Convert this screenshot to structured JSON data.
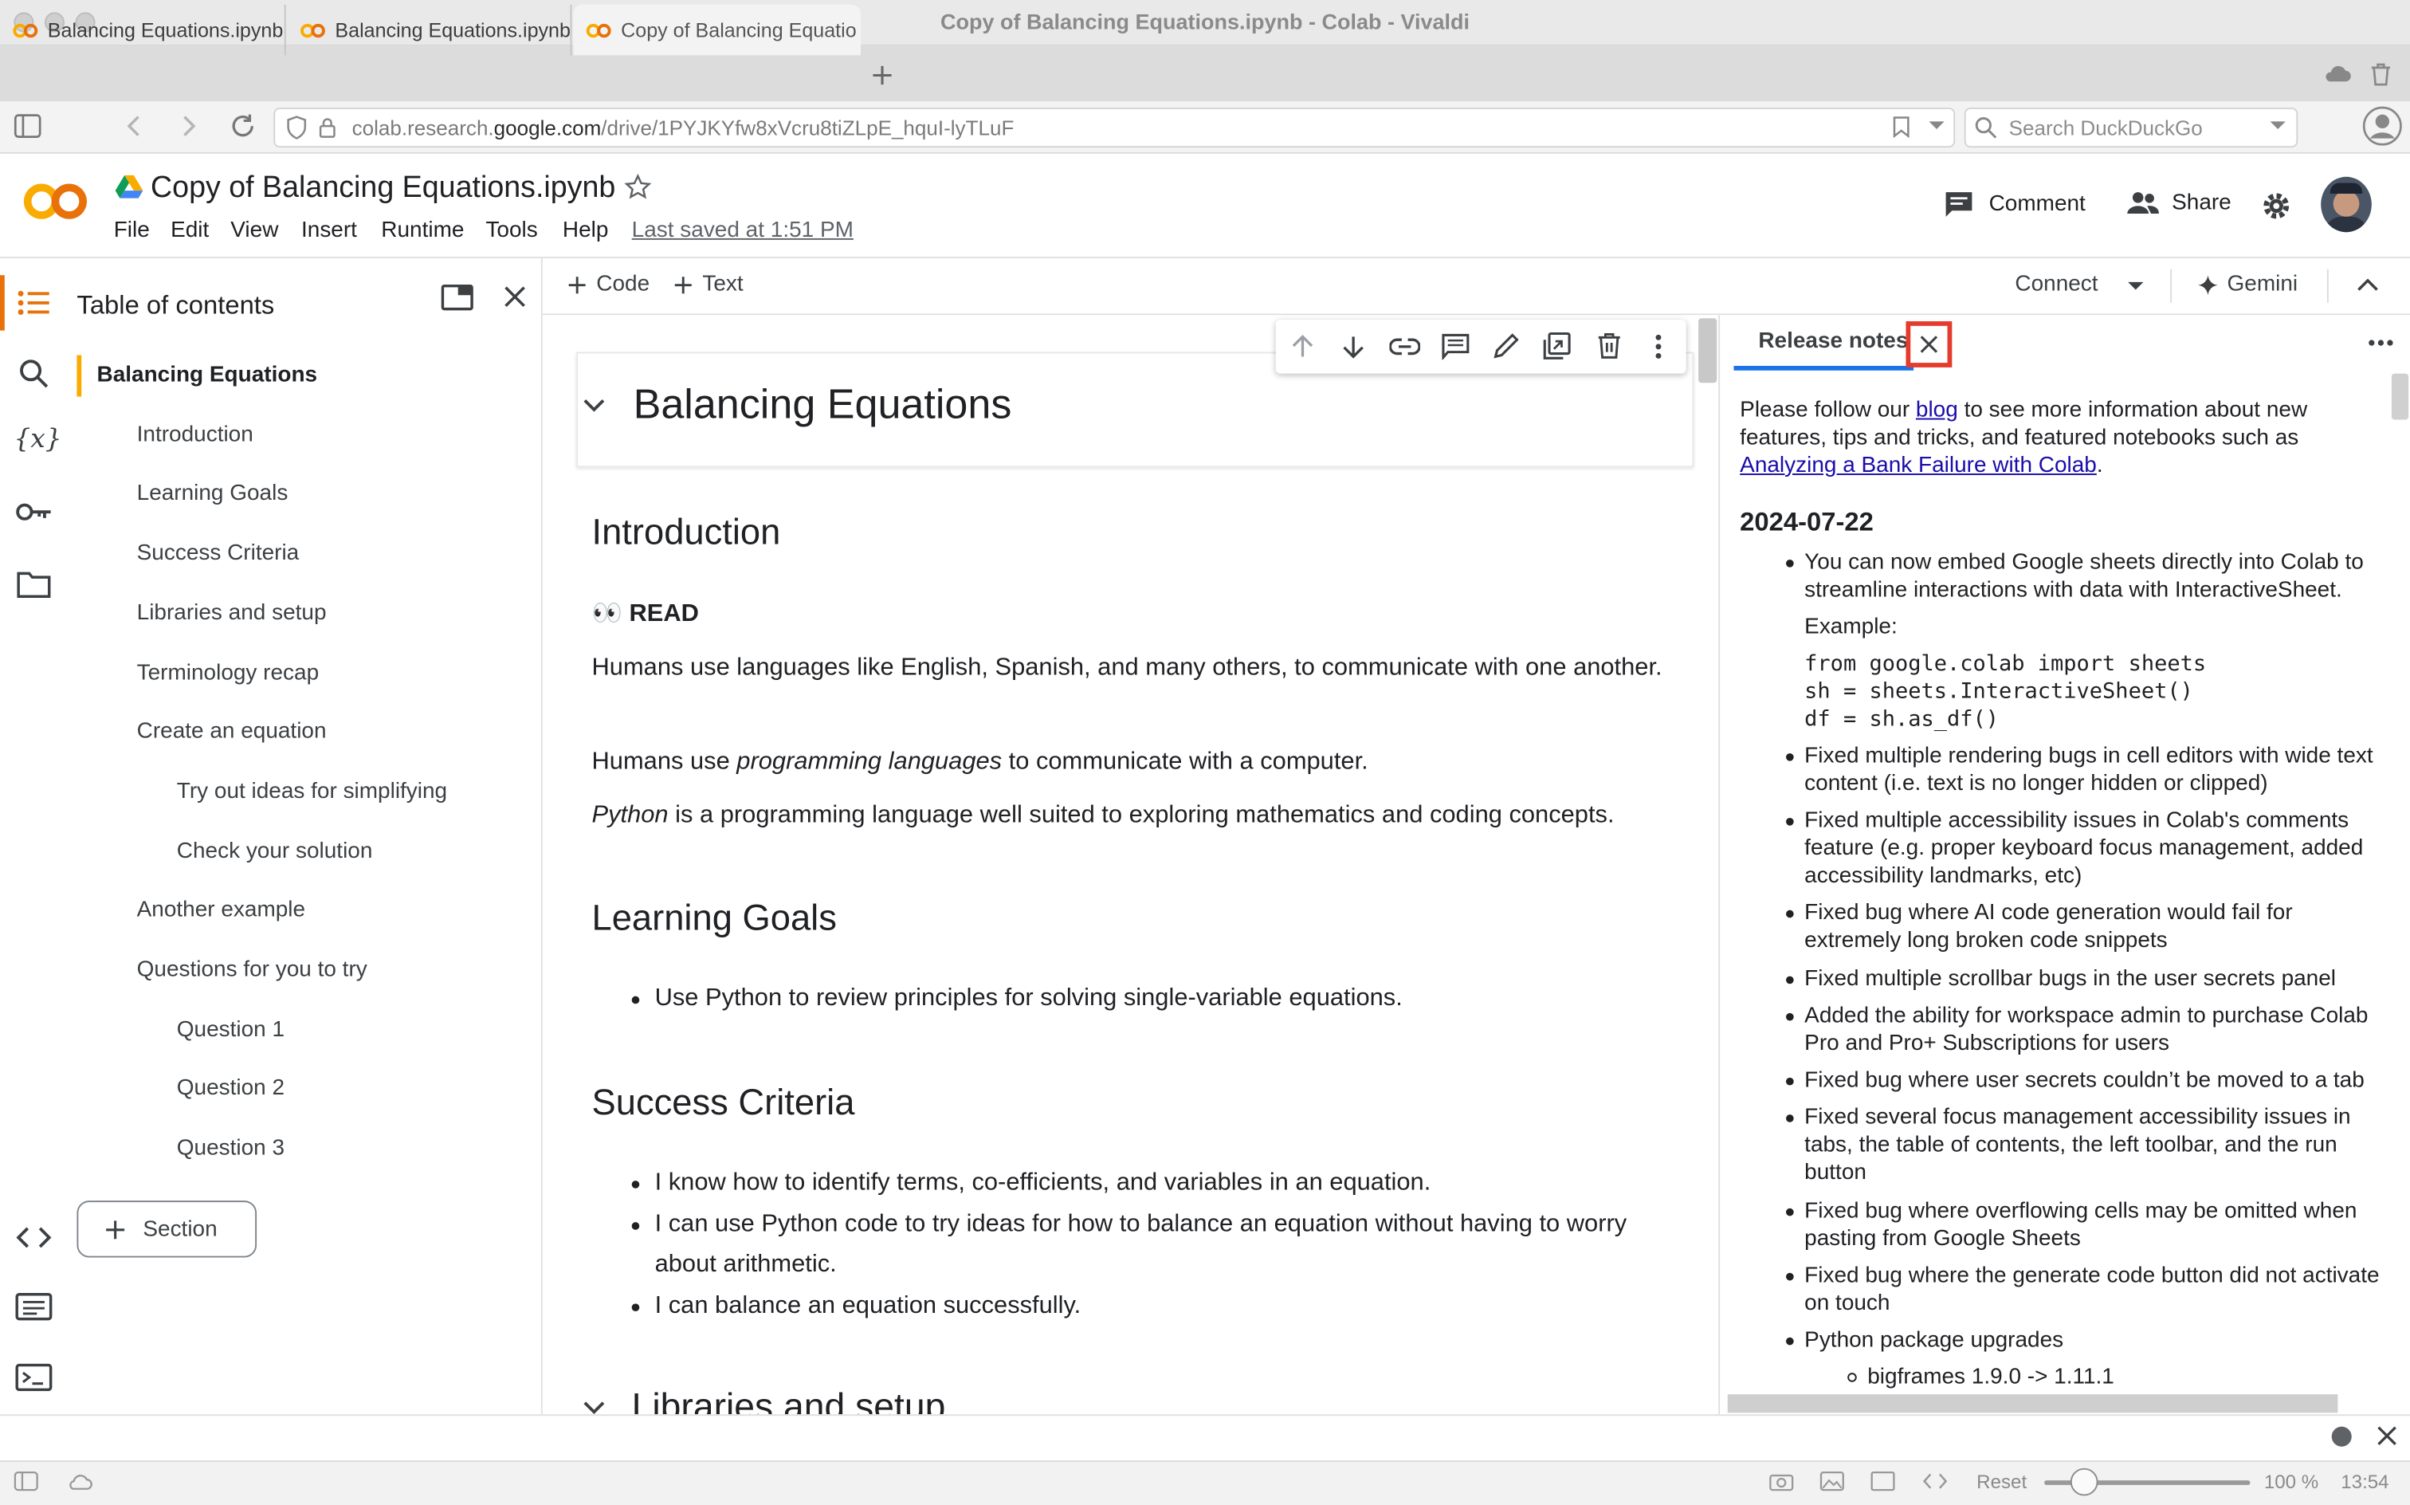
{
  "window": {
    "title": "Copy of Balancing Equations.ipynb - Colab - Vivaldi"
  },
  "browser_tabs": [
    {
      "label": "Balancing Equations.ipynb"
    },
    {
      "label": "Balancing Equations.ipynb"
    },
    {
      "label": "Copy of Balancing Equatio"
    }
  ],
  "address": {
    "prefix": "colab.research.",
    "host": "google.com",
    "path": "/drive/1PYJKYfw8xVcru8tiZLpE_hquI-lyTLuF"
  },
  "search": {
    "placeholder": "Search DuckDuckGo"
  },
  "colab": {
    "notebook_title": "Copy of Balancing Equations.ipynb",
    "menu": [
      "File",
      "Edit",
      "View",
      "Insert",
      "Runtime",
      "Tools",
      "Help"
    ],
    "last_saved": "Last saved at 1:51 PM",
    "comment_label": "Comment",
    "share_label": "Share",
    "add_code": "Code",
    "add_text": "Text",
    "connect_label": "Connect",
    "gemini_label": "Gemini"
  },
  "toc": {
    "title": "Table of contents",
    "items": [
      {
        "label": "Balancing Equations",
        "level": 1
      },
      {
        "label": "Introduction",
        "level": 2
      },
      {
        "label": "Learning Goals",
        "level": 2
      },
      {
        "label": "Success Criteria",
        "level": 2
      },
      {
        "label": "Libraries and setup",
        "level": 2
      },
      {
        "label": "Terminology recap",
        "level": 2
      },
      {
        "label": "Create an equation",
        "level": 2
      },
      {
        "label": "Try out ideas for simplifying",
        "level": 3
      },
      {
        "label": "Check your solution",
        "level": 3
      },
      {
        "label": "Another example",
        "level": 2
      },
      {
        "label": "Questions for you to try",
        "level": 2
      },
      {
        "label": "Question 1",
        "level": 3
      },
      {
        "label": "Question 2",
        "level": 3
      },
      {
        "label": "Question 3",
        "level": 3
      }
    ],
    "section_button": "Section"
  },
  "notebook": {
    "heading": "Balancing Equations",
    "intro_heading": "Introduction",
    "read_label": "READ",
    "read_emoji": "👀",
    "para1": "Humans use languages like English, Spanish, and many others, to communicate with one another.",
    "para2_pre": "Humans use ",
    "para2_em": "programming languages",
    "para2_post": " to communicate with a computer.",
    "para3_em": "Python",
    "para3_post": " is a programming language well suited to exploring mathematics and coding concepts.",
    "goals_heading": "Learning Goals",
    "goals": [
      "Use Python to review principles for solving single-variable equations."
    ],
    "criteria_heading": "Success Criteria",
    "criteria": [
      "I know how to identify terms, co-efficients, and variables in an equation.",
      "I can use Python code to try ideas for how to balance an equation without having to worry about arithmetic.",
      "I can balance an equation successfully."
    ],
    "libs_heading": "Libraries and setup"
  },
  "release_notes": {
    "tab_label": "Release notes",
    "intro_pre": "Please follow our ",
    "intro_link": "blog",
    "intro_mid": " to see more information about new features, tips and tricks, and featured notebooks such as ",
    "intro_link2": "Analyzing a Bank Failure with Colab",
    "intro_end": ".",
    "date": "2024-07-22",
    "item1": "You can now embed Google sheets directly into Colab to streamline interactions with data with InteractiveSheet.",
    "example_label": "Example:",
    "code": "from google.colab import sheets\nsh = sheets.InteractiveSheet()\ndf = sh.as_df()",
    "items": [
      "Fixed multiple rendering bugs in cell editors with wide text content (i.e. text is no longer hidden or clipped)",
      "Fixed multiple accessibility issues in Colab's comments feature (e.g. proper keyboard focus management, added accessibility landmarks, etc)",
      "Fixed bug where AI code generation would fail for extremely long broken code snippets",
      "Fixed multiple scrollbar bugs in the user secrets panel",
      "Added the ability for workspace admin to purchase Colab Pro and Pro+ Subscriptions for users",
      "Fixed bug where user secrets couldn’t be moved to a tab",
      "Fixed several focus management accessibility issues in tabs, the table of contents, the left toolbar, and the run button",
      "Fixed bug where overflowing cells may be omitted when pasting from Google Sheets",
      "Fixed bug where the generate code button did not activate on touch",
      "Python package upgrades"
    ],
    "sub_item": "bigframes 1.9.0 -> 1.11.1"
  },
  "statusbar": {
    "reset_label": "Reset",
    "zoom": "100 %",
    "time": "13:54"
  },
  "colors": {
    "colab_orange": "#f9ab00",
    "colab_orange_dark": "#e8710a",
    "link": "#1a0dab",
    "highlight_box": "#e53b2c"
  }
}
